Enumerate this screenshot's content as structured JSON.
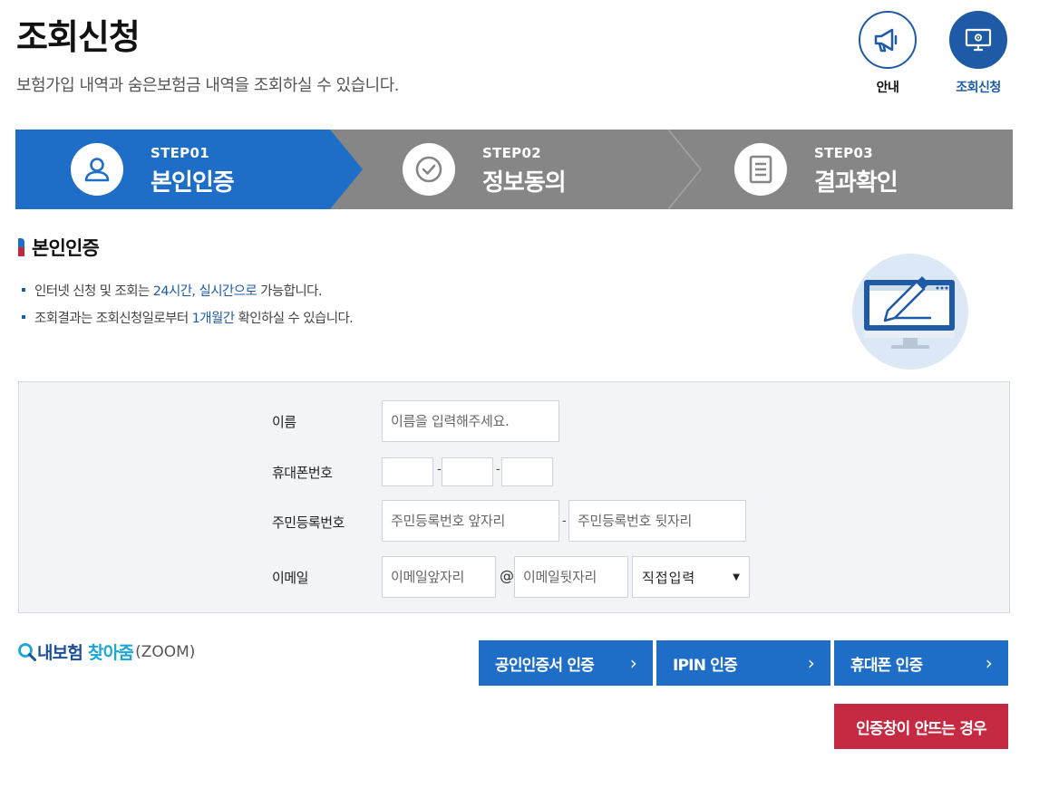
{
  "header": {
    "title": "조회신청",
    "description": "보험가입 내역과 숨은보험금 내역을 조회하실 수 있습니다.",
    "guide_label": "안내",
    "inquiry_label": "조회신청",
    "accent_color": "#1f5aa6"
  },
  "steps": [
    {
      "no": "STEP01",
      "name": "본인인증",
      "icon": "user-icon",
      "active": true
    },
    {
      "no": "STEP02",
      "name": "정보동의",
      "icon": "check-circle-icon",
      "active": false
    },
    {
      "no": "STEP03",
      "name": "결과확인",
      "icon": "document-icon",
      "active": false
    }
  ],
  "section": {
    "title": "본인인증",
    "bullet1": {
      "pre": "인터넷 신청 및 조회는 ",
      "hl": "24시간, 실시간으로",
      "post": " 가능합니다."
    },
    "bullet2": {
      "pre": "조회결과는 조회신청일로부터 ",
      "hl": "1개월간",
      "post": " 확인하실 수 있습니다."
    }
  },
  "form": {
    "name_label": "이름",
    "name_placeholder": "이름을 입력해주세요.",
    "phone_label": "휴대폰번호",
    "phone_sep": "-",
    "rrn_label": "주민등록번호",
    "rrn_front_placeholder": "주민등록번호 앞자리",
    "rrn_back_placeholder": "주민등록번호 뒷자리",
    "email_label": "이메일",
    "email_local_placeholder": "이메일앞자리",
    "email_at": "@",
    "email_domain_placeholder": "이메일뒷자리",
    "email_domain_select": "직접입력"
  },
  "zoom": {
    "part1": "내보험",
    "part2": "찾아줌",
    "part3": "(ZOOM)"
  },
  "auth_buttons": {
    "cert": "공인인증서 인증",
    "ipin": "IPIN 인증",
    "phone": "휴대폰 인증",
    "arrow": "›"
  },
  "help_button": "인증창이 안뜨는 경우",
  "colors": {
    "step_active": "#1e6ec8",
    "step_inactive": "#868686",
    "button_blue": "#1e6ec8",
    "button_red": "#c42a41"
  }
}
